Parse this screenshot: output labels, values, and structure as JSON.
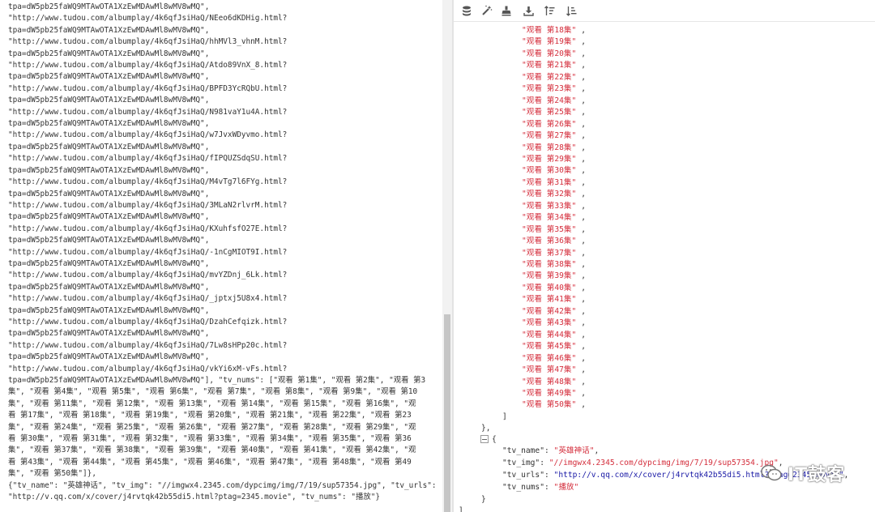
{
  "left": {
    "text": "tpa=dW5pb25faWQ9MTAwOTA1XzEwMDAwMl8wMV8wMQ\",\n\"http://www.tudou.com/albumplay/4k6qfJsiHaQ/NEeo6dKDHig.html?\ntpa=dW5pb25faWQ9MTAwOTA1XzEwMDAwMl8wMV8wMQ\",\n\"http://www.tudou.com/albumplay/4k6qfJsiHaQ/hhMVl3_vhnM.html?\ntpa=dW5pb25faWQ9MTAwOTA1XzEwMDAwMl8wMV8wMQ\",\n\"http://www.tudou.com/albumplay/4k6qfJsiHaQ/Atdo89VnX_8.html?\ntpa=dW5pb25faWQ9MTAwOTA1XzEwMDAwMl8wMV8wMQ\",\n\"http://www.tudou.com/albumplay/4k6qfJsiHaQ/BPFD3YcRQbU.html?\ntpa=dW5pb25faWQ9MTAwOTA1XzEwMDAwMl8wMV8wMQ\",\n\"http://www.tudou.com/albumplay/4k6qfJsiHaQ/N981vaY1u4A.html?\ntpa=dW5pb25faWQ9MTAwOTA1XzEwMDAwMl8wMV8wMQ\",\n\"http://www.tudou.com/albumplay/4k6qfJsiHaQ/w7JvxWDyvmo.html?\ntpa=dW5pb25faWQ9MTAwOTA1XzEwMDAwMl8wMV8wMQ\",\n\"http://www.tudou.com/albumplay/4k6qfJsiHaQ/fIPQUZSdqSU.html?\ntpa=dW5pb25faWQ9MTAwOTA1XzEwMDAwMl8wMV8wMQ\",\n\"http://www.tudou.com/albumplay/4k6qfJsiHaQ/M4vTg7l6FYg.html?\ntpa=dW5pb25faWQ9MTAwOTA1XzEwMDAwMl8wMV8wMQ\",\n\"http://www.tudou.com/albumplay/4k6qfJsiHaQ/3MLaN2rlvrM.html?\ntpa=dW5pb25faWQ9MTAwOTA1XzEwMDAwMl8wMV8wMQ\",\n\"http://www.tudou.com/albumplay/4k6qfJsiHaQ/KXuhfsfO27E.html?\ntpa=dW5pb25faWQ9MTAwOTA1XzEwMDAwMl8wMV8wMQ\",\n\"http://www.tudou.com/albumplay/4k6qfJsiHaQ/-1nCgMIOT9I.html?\ntpa=dW5pb25faWQ9MTAwOTA1XzEwMDAwMl8wMV8wMQ\",\n\"http://www.tudou.com/albumplay/4k6qfJsiHaQ/mvYZDnj_6Lk.html?\ntpa=dW5pb25faWQ9MTAwOTA1XzEwMDAwMl8wMV8wMQ\",\n\"http://www.tudou.com/albumplay/4k6qfJsiHaQ/_jptxj5U8x4.html?\ntpa=dW5pb25faWQ9MTAwOTA1XzEwMDAwMl8wMV8wMQ\",\n\"http://www.tudou.com/albumplay/4k6qfJsiHaQ/DzahCefqizk.html?\ntpa=dW5pb25faWQ9MTAwOTA1XzEwMDAwMl8wMV8wMQ\",\n\"http://www.tudou.com/albumplay/4k6qfJsiHaQ/7Lw8sHPp20c.html?\ntpa=dW5pb25faWQ9MTAwOTA1XzEwMDAwMl8wMV8wMQ\",\n\"http://www.tudou.com/albumplay/4k6qfJsiHaQ/vkYi6xM-vFs.html?\ntpa=dW5pb25faWQ9MTAwOTA1XzEwMDAwMl8wMV8wMQ\"], \"tv_nums\": [\"观看 第1集\", \"观看 第2集\", \"观看 第3\n集\", \"观看 第4集\", \"观看 第5集\", \"观看 第6集\", \"观看 第7集\", \"观看 第8集\", \"观看 第9集\", \"观看 第10\n集\", \"观看 第11集\", \"观看 第12集\", \"观看 第13集\", \"观看 第14集\", \"观看 第15集\", \"观看 第16集\", \"观\n看 第17集\", \"观看 第18集\", \"观看 第19集\", \"观看 第20集\", \"观看 第21集\", \"观看 第22集\", \"观看 第23\n集\", \"观看 第24集\", \"观看 第25集\", \"观看 第26集\", \"观看 第27集\", \"观看 第28集\", \"观看 第29集\", \"观\n看 第30集\", \"观看 第31集\", \"观看 第32集\", \"观看 第33集\", \"观看 第34集\", \"观看 第35集\", \"观看 第36\n集\", \"观看 第37集\", \"观看 第38集\", \"观看 第39集\", \"观看 第40集\", \"观看 第41集\", \"观看 第42集\", \"观\n看 第43集\", \"观看 第44集\", \"观看 第45集\", \"观看 第46集\", \"观看 第47集\", \"观看 第48集\", \"观看 第49\n集\", \"观看 第50集\"]},\n{\"tv_name\": \"英雄神话\", \"tv_img\": \"//imgwx4.2345.com/dypcimg/img/7/19/sup57354.jpg\", \"tv_urls\":\n\"http://v.qq.com/x/cover/j4rvtqk42b55di5.html?ptag=2345.movie\", \"tv_nums\": \"播放\"}"
  },
  "toolbar": {
    "icons": [
      "database-icon",
      "magic-wand-icon",
      "clear-icon",
      "download-icon",
      "sort-ascending-icon",
      "sort-descending-icon"
    ]
  },
  "json_view": {
    "episodes": [
      "\"观看 第18集\"",
      "\"观看 第19集\"",
      "\"观看 第20集\"",
      "\"观看 第21集\"",
      "\"观看 第22集\"",
      "\"观看 第23集\"",
      "\"观看 第24集\"",
      "\"观看 第25集\"",
      "\"观看 第26集\"",
      "\"观看 第27集\"",
      "\"观看 第28集\"",
      "\"观看 第29集\"",
      "\"观看 第30集\"",
      "\"观看 第31集\"",
      "\"观看 第32集\"",
      "\"观看 第33集\"",
      "\"观看 第34集\"",
      "\"观看 第35集\"",
      "\"观看 第36集\"",
      "\"观看 第37集\"",
      "\"观看 第38集\"",
      "\"观看 第39集\"",
      "\"观看 第40集\"",
      "\"观看 第41集\"",
      "\"观看 第42集\"",
      "\"观看 第43集\"",
      "\"观看 第44集\"",
      "\"观看 第45集\"",
      "\"观看 第46集\"",
      "\"观看 第47集\"",
      "\"观看 第48集\"",
      "\"观看 第49集\"",
      "\"观看 第50集\""
    ],
    "comma": ",",
    "close_bracket": "]",
    "close_obj": "},",
    "open_obj": "{",
    "name_key": "\"tv_name\":",
    "name_val": "\"英雄神话\"",
    "img_key": "\"tv_img\":",
    "img_val": "\"//imgwx4.2345.com/dypcimg/img/7/19/sup57354.jpg\"",
    "urls_key": "\"tv_urls\":",
    "urls_val": "\"http://v.qq.com/x/cover/j4rvtqk42b55di5.html?ptag=2345.movie\"",
    "nums_key": "\"tv_nums\":",
    "nums_val": "\"播放\"",
    "close_inner": "}",
    "close_outer": "]"
  },
  "watermark": {
    "text": "IT鼓客"
  }
}
